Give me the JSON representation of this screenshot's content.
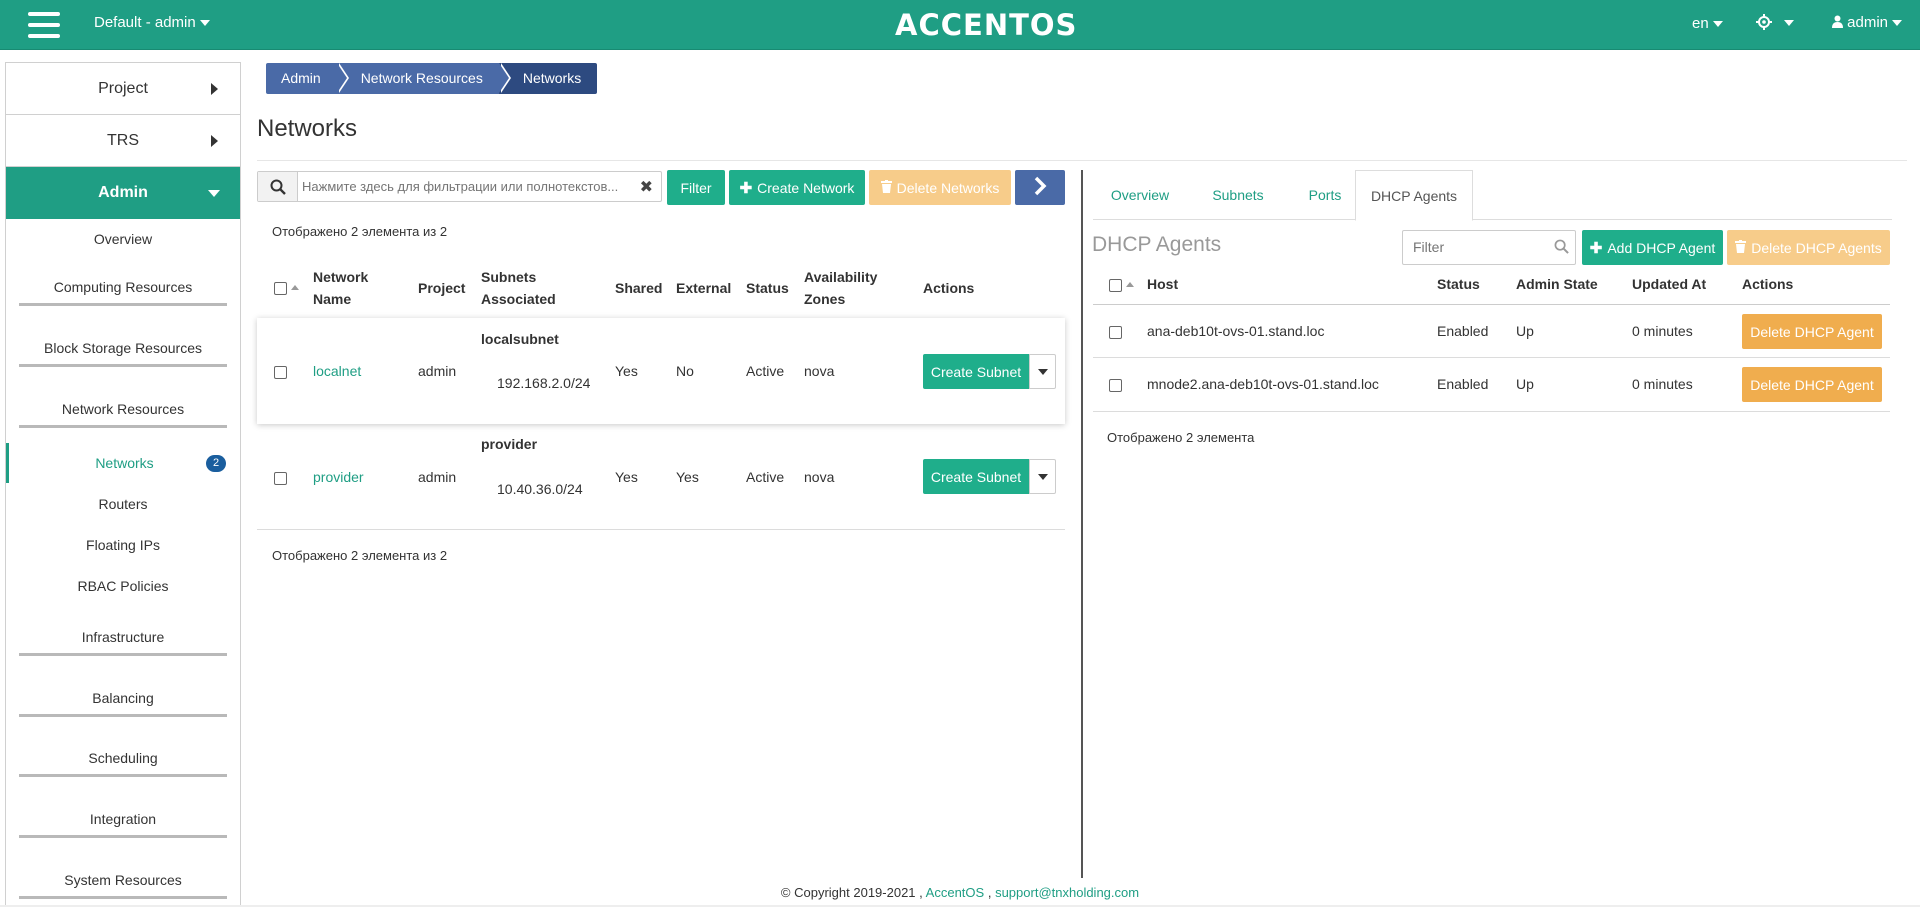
{
  "topbar": {
    "project": "Default - admin",
    "logo": "ACCENTOS",
    "lang": "en",
    "user": "admin",
    "accent": "#1f9e84"
  },
  "sidebar": {
    "project": "Project",
    "trs": "TRS",
    "admin": "Admin",
    "items": {
      "overview": "Overview",
      "computing": "Computing Resources",
      "block_storage": "Block Storage Resources",
      "network": "Network Resources",
      "networks": "Networks",
      "networks_badge": "2",
      "routers": "Routers",
      "floating": "Floating IPs",
      "rbac": "RBAC Policies",
      "infra": "Infrastructure",
      "balancing": "Balancing",
      "scheduling": "Scheduling",
      "integration": "Integration",
      "system": "System Resources"
    }
  },
  "breadcrumb": [
    "Admin",
    "Network Resources",
    "Networks"
  ],
  "page_title": "Networks",
  "networks": {
    "search_placeholder": "Нажмите здесь для фильтрации или полнотекстов...",
    "filter_btn": "Filter",
    "create_btn": "Create Network",
    "delete_btn": "Delete Networks",
    "count_top": "Отображено 2 элемента из 2",
    "count_bottom": "Отображено 2 элемента из 2",
    "columns": {
      "name_1": "Network",
      "name_2": "Name",
      "project": "Project",
      "subnets_1": "Subnets",
      "subnets_2": "Associated",
      "shared": "Shared",
      "external": "External",
      "status": "Status",
      "zones_1": "Availability",
      "zones_2": "Zones",
      "actions": "Actions"
    },
    "rows": [
      {
        "name": "localnet",
        "project": "admin",
        "subnet_name": "localsubnet",
        "subnet_cidr": "192.168.2.0/24",
        "shared": "Yes",
        "external": "No",
        "status": "Active",
        "zone": "nova",
        "action": "Create Subnet"
      },
      {
        "name": "provider",
        "project": "admin",
        "subnet_name": "provider",
        "subnet_cidr": "10.40.36.0/24",
        "shared": "Yes",
        "external": "Yes",
        "status": "Active",
        "zone": "nova",
        "action": "Create Subnet"
      }
    ]
  },
  "detail": {
    "tabs": [
      "Overview",
      "Subnets",
      "Ports",
      "DHCP Agents"
    ],
    "title": "DHCP Agents",
    "filter_placeholder": "Filter",
    "add_btn": "Add DHCP Agent",
    "delete_btn": "Delete DHCP Agents",
    "columns": {
      "host": "Host",
      "status": "Status",
      "admin_state": "Admin State",
      "updated": "Updated At",
      "actions": "Actions"
    },
    "rows": [
      {
        "host": "ana-deb10t-ovs-01.stand.loc",
        "status": "Enabled",
        "admin_state": "Up",
        "updated": "0 minutes",
        "action": "Delete DHCP Agent"
      },
      {
        "host": "mnode2.ana-deb10t-ovs-01.stand.loc",
        "status": "Enabled",
        "admin_state": "Up",
        "updated": "0 minutes",
        "action": "Delete DHCP Agent"
      }
    ],
    "count": "Отображено 2 элемента"
  },
  "footer": {
    "copyright": "© Copyright 2019-2021 ,",
    "brand": "AccentOS",
    "sep": ",",
    "email": "support@tnxholding.com"
  }
}
